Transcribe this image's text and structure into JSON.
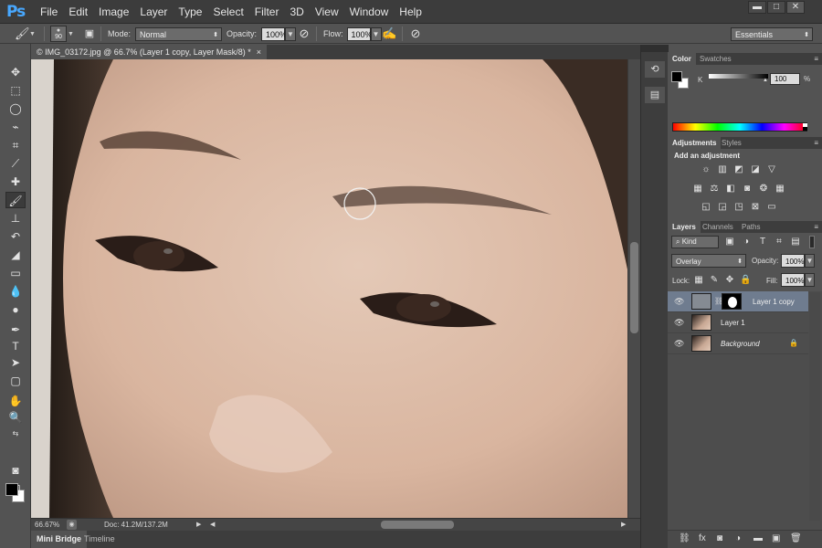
{
  "app": {
    "logo": "Ps"
  },
  "menu": [
    "File",
    "Edit",
    "Image",
    "Layer",
    "Type",
    "Select",
    "Filter",
    "3D",
    "View",
    "Window",
    "Help"
  ],
  "window_controls": {
    "minimize": "▬",
    "maximize": "□",
    "close": "✕"
  },
  "options_bar": {
    "brush_size": "90",
    "mode_label": "Mode:",
    "mode_value": "Normal",
    "opacity_label": "Opacity:",
    "opacity_value": "100%",
    "flow_label": "Flow:",
    "flow_value": "100%",
    "workspace": "Essentials"
  },
  "document": {
    "tab_title": "© IMG_03172.jpg @ 66.7% (Layer 1 copy, Layer Mask/8) *",
    "tab_close": "×",
    "zoom": "66.67%",
    "doc_size": "Doc: 41.2M/137.2M"
  },
  "bottom_tabs": [
    "Mini Bridge",
    "Timeline"
  ],
  "color_panel": {
    "tabs": [
      "Color",
      "Swatches"
    ],
    "channel": "K",
    "value": "100",
    "unit": "%"
  },
  "adjustments_panel": {
    "tabs": [
      "Adjustments",
      "Styles"
    ],
    "heading": "Add an adjustment"
  },
  "layers_panel": {
    "tabs": [
      "Layers",
      "Channels",
      "Paths"
    ],
    "filter_kind": "Kind",
    "blend_mode": "Overlay",
    "opacity_label": "Opacity:",
    "opacity_value": "100%",
    "lock_label": "Lock:",
    "fill_label": "Fill:",
    "fill_value": "100%",
    "layers": [
      {
        "name": "Layer 1 copy",
        "selected": true
      },
      {
        "name": "Layer 1",
        "selected": false
      },
      {
        "name": "Background",
        "selected": false
      }
    ]
  },
  "icons": {
    "toolbar": [
      "move-icon",
      "marquee-icon",
      "lasso-icon",
      "quick-select-icon",
      "crop-icon",
      "eyedropper-icon",
      "healing-icon",
      "brush-icon",
      "clone-stamp-icon",
      "history-brush-icon",
      "eraser-icon",
      "gradient-icon",
      "blur-icon",
      "dodge-icon",
      "pen-icon",
      "type-icon",
      "path-select-icon",
      "shape-icon",
      "hand-icon",
      "zoom-icon",
      "quick-mask-icon",
      "screen-mode-icon"
    ]
  }
}
